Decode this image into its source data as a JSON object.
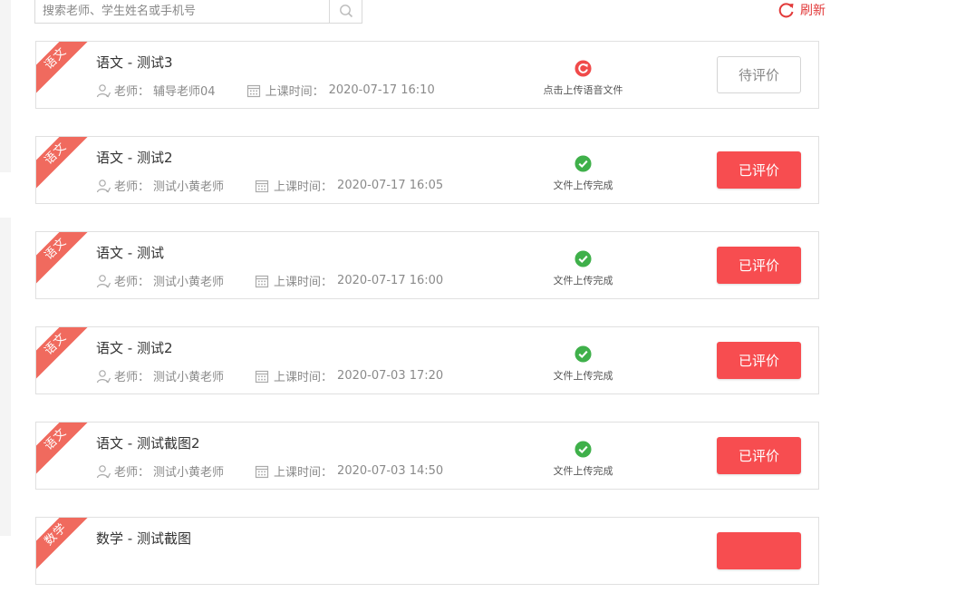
{
  "search": {
    "placeholder": "搜索老师、学生姓名或手机号"
  },
  "refresh": {
    "label": "刷新"
  },
  "colors": {
    "accent": "#f74d50",
    "ribbon": "#f06a5e",
    "success": "#3fb04a"
  },
  "teacher_prefix": "老师：",
  "time_prefix": "上课时间：",
  "items": [
    {
      "subject": "语文",
      "title": "语文 - 测试3",
      "teacher": "辅导老师04",
      "time": "2020-07-17 16:10",
      "status": "点击上传语音文件",
      "status_icon": "upload-icon",
      "action": "待评价",
      "state": "pending"
    },
    {
      "subject": "语文",
      "title": "语文 - 测试2",
      "teacher": "测试小黄老师",
      "time": "2020-07-17 16:05",
      "status": "文件上传完成",
      "status_icon": "check-icon",
      "action": "已评价",
      "state": "done"
    },
    {
      "subject": "语文",
      "title": "语文 - 测试",
      "teacher": "测试小黄老师",
      "time": "2020-07-17 16:00",
      "status": "文件上传完成",
      "status_icon": "check-icon",
      "action": "已评价",
      "state": "done"
    },
    {
      "subject": "语文",
      "title": "语文 - 测试2",
      "teacher": "测试小黄老师",
      "time": "2020-07-03 17:20",
      "status": "文件上传完成",
      "status_icon": "check-icon",
      "action": "已评价",
      "state": "done"
    },
    {
      "subject": "语文",
      "title": "语文 - 测试截图2",
      "teacher": "测试小黄老师",
      "time": "2020-07-03 14:50",
      "status": "文件上传完成",
      "status_icon": "check-icon",
      "action": "已评价",
      "state": "done"
    },
    {
      "subject": "数学",
      "title": "数学 - 测试截图",
      "teacher": "",
      "time": "",
      "status": "",
      "status_icon": "",
      "action": "",
      "state": "done"
    }
  ]
}
